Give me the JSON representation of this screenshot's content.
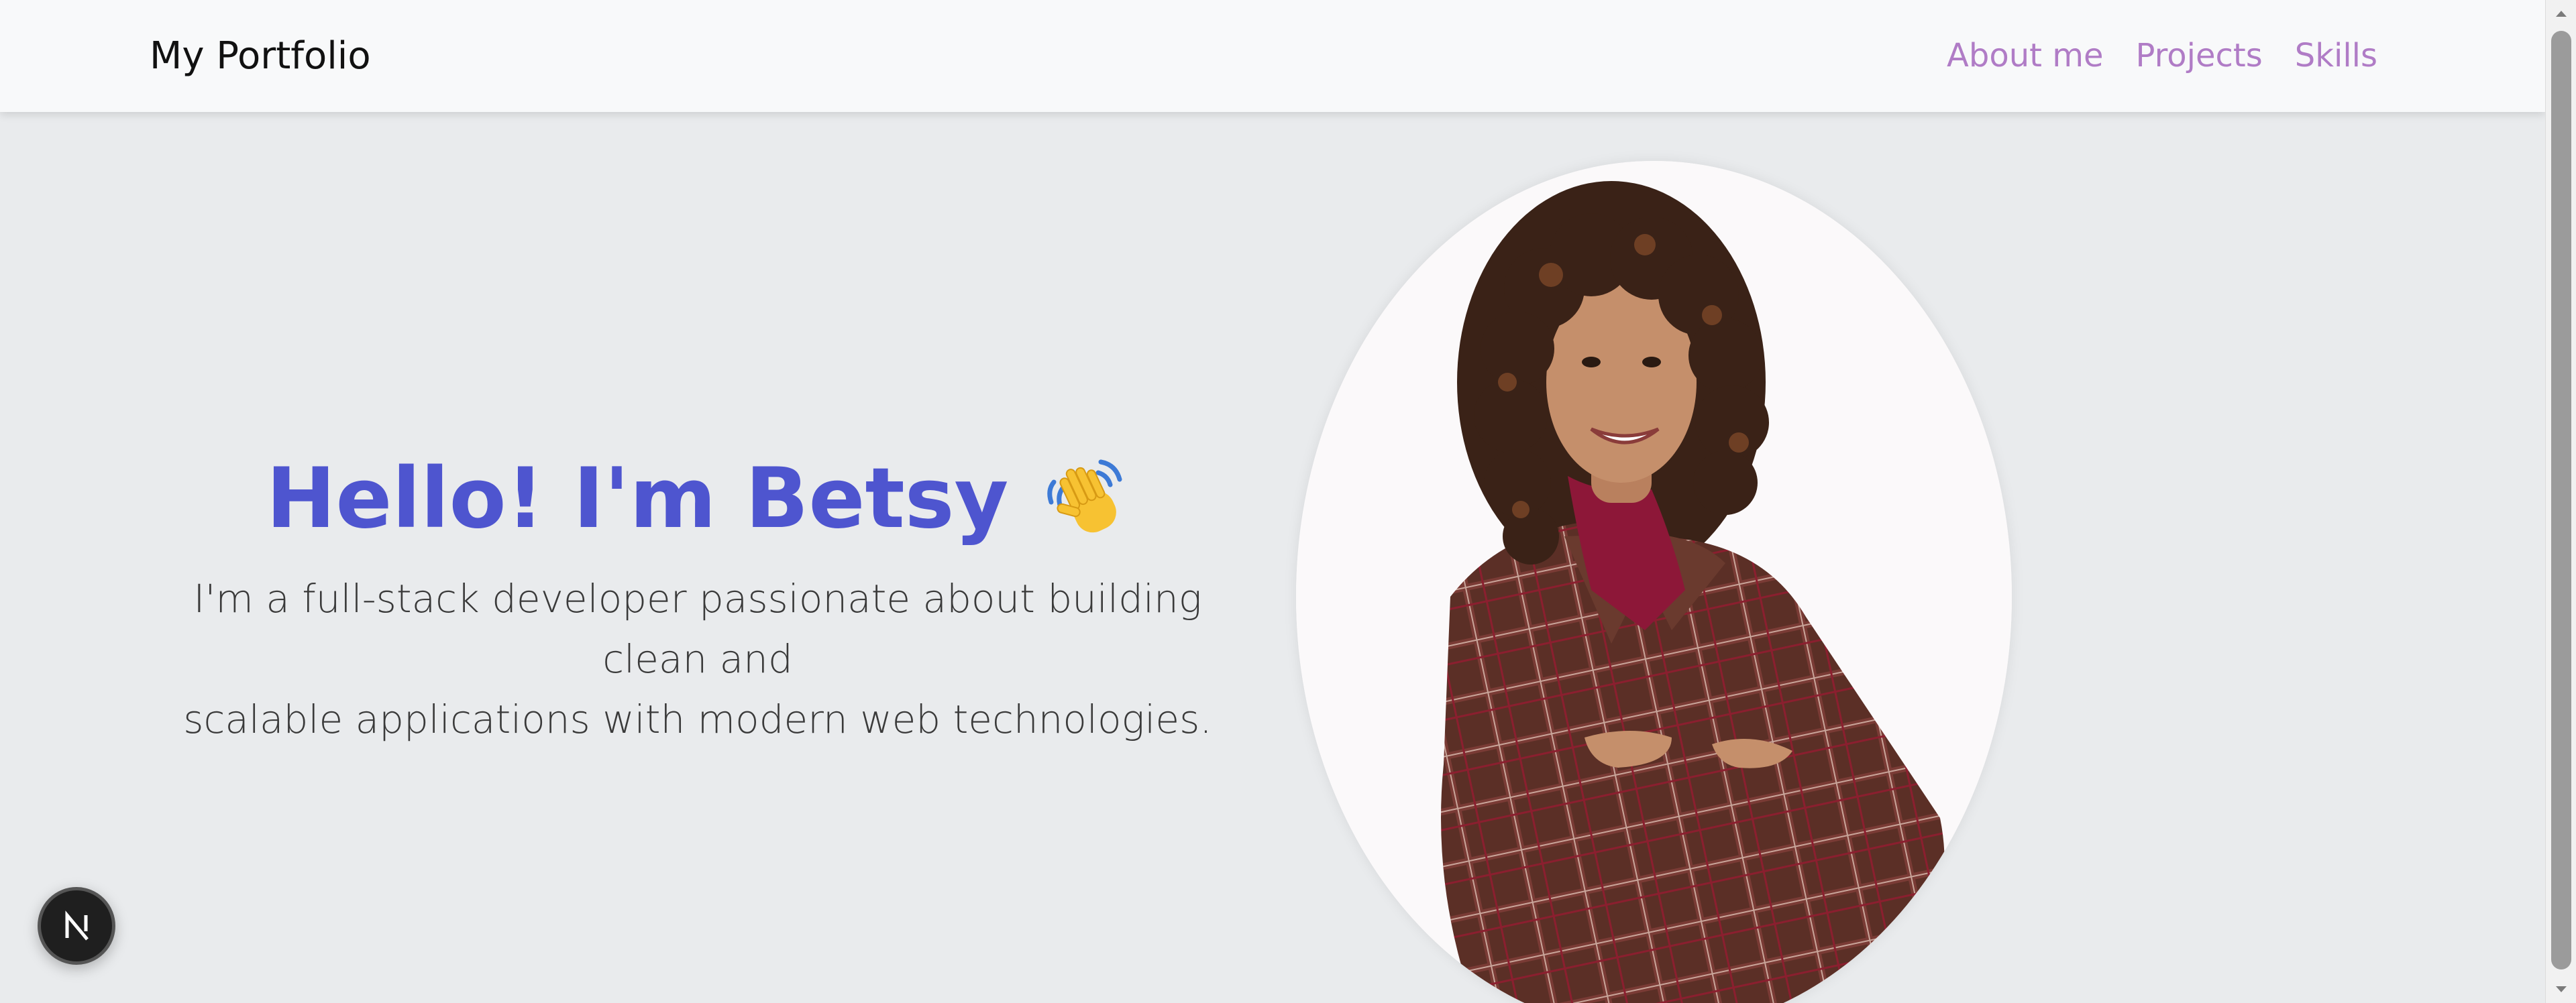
{
  "navbar": {
    "brand": "My Portfolio",
    "links": [
      "About me",
      "Projects",
      "Skills"
    ]
  },
  "hero": {
    "greeting": "Hello! I'm Betsy",
    "greeting_icon": "waving-hand-icon",
    "subtitle_line1": "I'm a full-stack developer passionate about building clean and",
    "subtitle_line2": "scalable applications with modern web technologies."
  },
  "portrait": {
    "icon": "profile-photo"
  },
  "badge": {
    "letter": "N"
  },
  "colors": {
    "accent": "#4e55cf",
    "nav_link": "#b07cc6",
    "background": "#e9ebed",
    "navbar_bg": "#f8f9fa"
  }
}
